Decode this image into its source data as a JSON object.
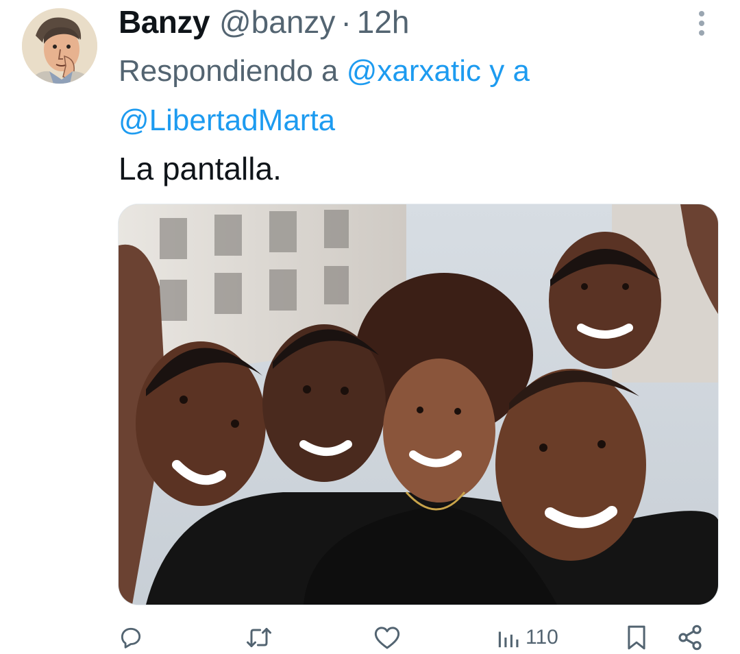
{
  "tweet": {
    "display_name": "Banzy",
    "handle": "@banzy",
    "separator": "·",
    "time": "12h",
    "replying_prefix": "Respondiendo a",
    "mention_1": "@xarxatic",
    "connector": "y a",
    "mention_2": "@LibertadMarta",
    "text": "La pantalla."
  },
  "actions": {
    "reply_icon": "reply-icon",
    "retweet_icon": "retweet-icon",
    "like_icon": "heart-icon",
    "views_icon": "views-icon",
    "views_count": "110",
    "bookmark_icon": "bookmark-icon",
    "share_icon": "share-icon"
  },
  "colors": {
    "accent": "#1d9bf0",
    "secondary_text": "#536471",
    "primary_text": "#0f1419"
  }
}
